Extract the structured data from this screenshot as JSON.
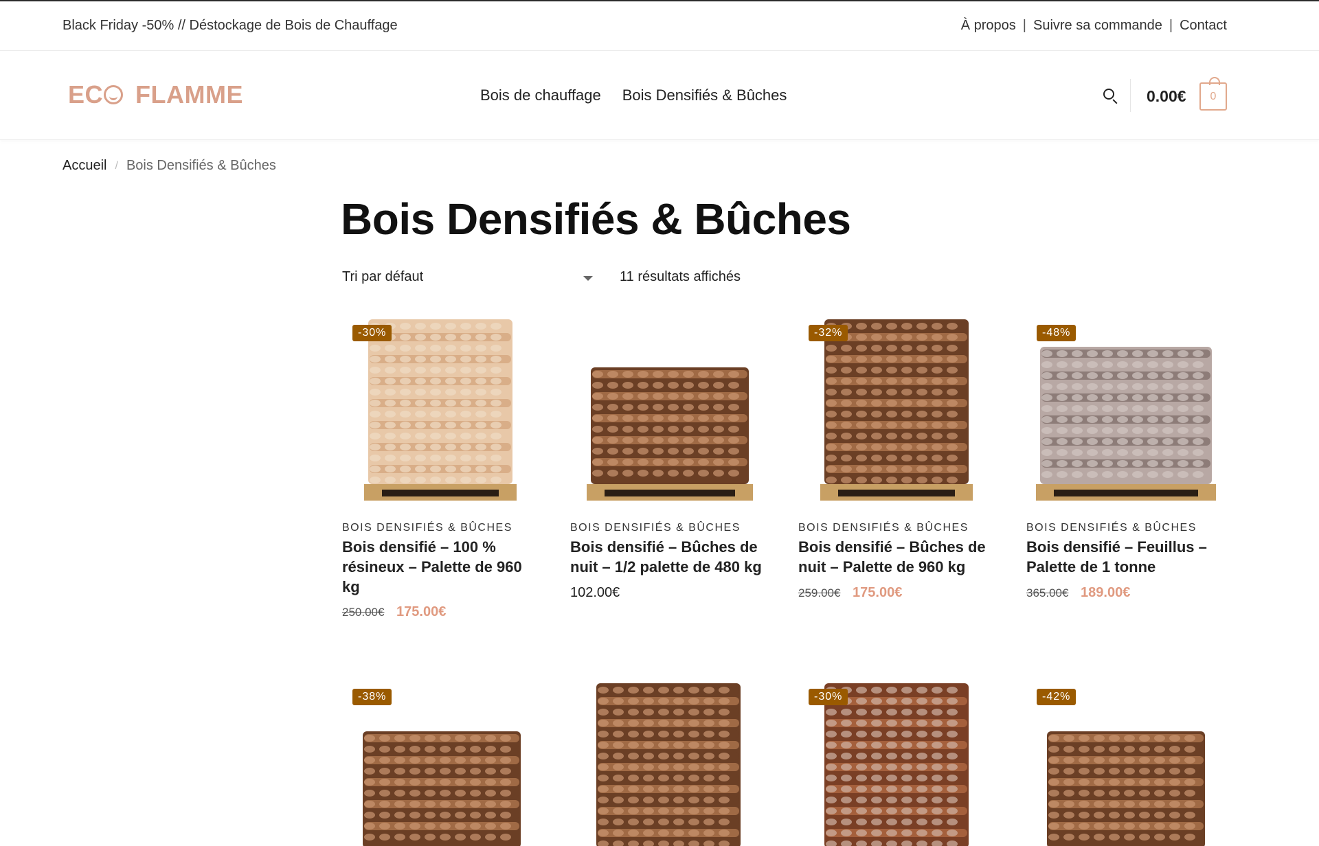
{
  "topbar": {
    "promo": "Black Friday -50% // Déstockage de Bois de Chauffage",
    "links": [
      "À propos",
      "Suivre sa commande",
      "Contact"
    ],
    "separator": "|"
  },
  "header": {
    "logo_left": "EC",
    "logo_right": "FLAMME",
    "nav": [
      "Bois de chauffage",
      "Bois Densifiés & Bûches"
    ],
    "cart_total": "0.00€",
    "cart_count": "0",
    "brand_color": "#d9a08a"
  },
  "breadcrumb": {
    "home": "Accueil",
    "separator": "/",
    "current": "Bois Densifiés & Bûches"
  },
  "page_title": "Bois Densifiés & Bûches",
  "toolbar": {
    "sort_label": "Tri par défaut",
    "results_label": "11 résultats affichés"
  },
  "products": [
    {
      "badge": "-30%",
      "category": "BOIS DENSIFIÉS & BÛCHES",
      "name": "Bois densifié – 100 % résineux – Palette de 960 kg",
      "old_price": "250.00€",
      "price": "175.00€",
      "tone": "light"
    },
    {
      "badge": "",
      "category": "BOIS DENSIFIÉS & BÛCHES",
      "name": "Bois densifié – Bûches de nuit – 1/2 palette de 480 kg",
      "old_price": "",
      "price": "102.00€",
      "tone": "dark"
    },
    {
      "badge": "-32%",
      "category": "BOIS DENSIFIÉS & BÛCHES",
      "name": "Bois densifié – Bûches de nuit – Palette de 960 kg",
      "old_price": "259.00€",
      "price": "175.00€",
      "tone": "dark"
    },
    {
      "badge": "-48%",
      "category": "BOIS DENSIFIÉS & BÛCHES",
      "name": "Bois densifié – Feuillus – Palette de 1 tonne",
      "old_price": "365.00€",
      "price": "189.00€",
      "tone": "grey"
    },
    {
      "badge": "-38%",
      "tone": "dark"
    },
    {
      "badge": "",
      "tone": "dark"
    },
    {
      "badge": "-30%",
      "tone": "wrapped"
    },
    {
      "badge": "-42%",
      "tone": "dark"
    }
  ]
}
